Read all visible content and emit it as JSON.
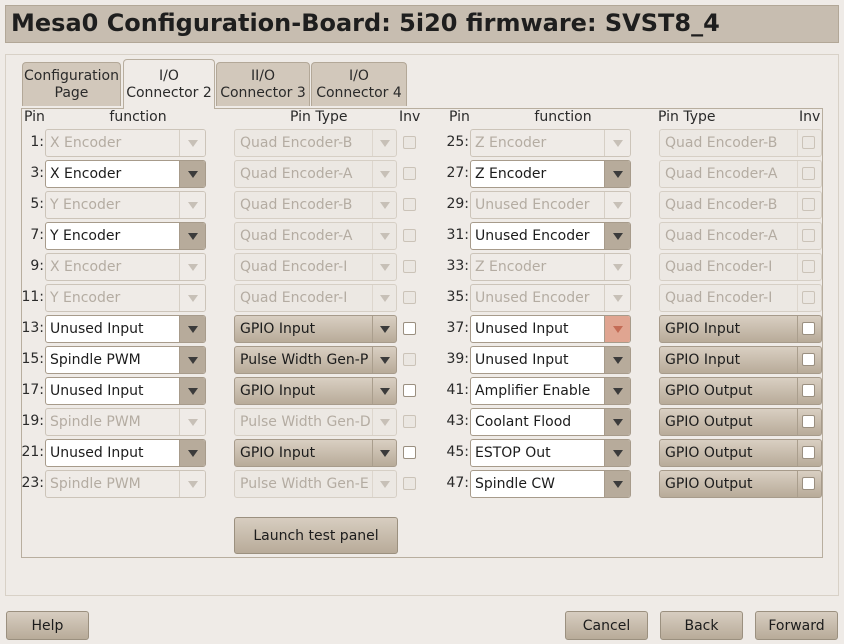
{
  "window": {
    "title": "Mesa0 Configuration-Board: 5i20 firmware: SVST8_4"
  },
  "tabs": [
    {
      "label": "Configuration\nPage",
      "active": false
    },
    {
      "label": "I/O\nConnector 2",
      "active": true
    },
    {
      "label": "II/O\nConnector 3",
      "active": false
    },
    {
      "label": "I/O\nConnector 4",
      "active": false
    }
  ],
  "columns": {
    "pin": "Pin",
    "function": "function",
    "pin_type": "Pin Type",
    "inv": "Inv"
  },
  "left_rows": [
    {
      "pin": "1:",
      "function": "X Encoder",
      "pin_type": "Quad Encoder-B",
      "enabled": false,
      "inv_enabled": false
    },
    {
      "pin": "3:",
      "function": "X Encoder",
      "pin_type": "Quad Encoder-A",
      "enabled": true,
      "type_enabled": false,
      "inv_enabled": false
    },
    {
      "pin": "5:",
      "function": "Y Encoder",
      "pin_type": "Quad Encoder-B",
      "enabled": false,
      "inv_enabled": false
    },
    {
      "pin": "7:",
      "function": "Y Encoder",
      "pin_type": "Quad Encoder-A",
      "enabled": true,
      "type_enabled": false,
      "inv_enabled": false
    },
    {
      "pin": "9:",
      "function": "X Encoder",
      "pin_type": "Quad Encoder-I",
      "enabled": false,
      "inv_enabled": false
    },
    {
      "pin": "11:",
      "function": "Y Encoder",
      "pin_type": "Quad Encoder-I",
      "enabled": false,
      "inv_enabled": false
    },
    {
      "pin": "13:",
      "function": "Unused Input",
      "pin_type": "GPIO Input",
      "enabled": true,
      "type_enabled": true,
      "inv_enabled": true
    },
    {
      "pin": "15:",
      "function": "Spindle PWM",
      "pin_type": "Pulse Width Gen-P",
      "enabled": true,
      "type_enabled": true,
      "inv_enabled": false
    },
    {
      "pin": "17:",
      "function": "Unused Input",
      "pin_type": "GPIO Input",
      "enabled": true,
      "type_enabled": true,
      "inv_enabled": true
    },
    {
      "pin": "19:",
      "function": "Spindle PWM",
      "pin_type": "Pulse Width Gen-D",
      "enabled": false,
      "inv_enabled": false
    },
    {
      "pin": "21:",
      "function": "Unused Input",
      "pin_type": "GPIO Input",
      "enabled": true,
      "type_enabled": true,
      "inv_enabled": true
    },
    {
      "pin": "23:",
      "function": "Spindle PWM",
      "pin_type": "Pulse Width Gen-E",
      "enabled": false,
      "inv_enabled": false
    }
  ],
  "right_rows": [
    {
      "pin": "25:",
      "function": "Z Encoder",
      "pin_type": "Quad Encoder-B",
      "enabled": false,
      "inv_enabled": false
    },
    {
      "pin": "27:",
      "function": "Z Encoder",
      "pin_type": "Quad Encoder-A",
      "enabled": true,
      "type_enabled": false,
      "inv_enabled": false
    },
    {
      "pin": "29:",
      "function": "Unused Encoder",
      "pin_type": "Quad Encoder-B",
      "enabled": false,
      "inv_enabled": false
    },
    {
      "pin": "31:",
      "function": "Unused Encoder",
      "pin_type": "Quad Encoder-A",
      "enabled": true,
      "type_enabled": false,
      "inv_enabled": false
    },
    {
      "pin": "33:",
      "function": "Z Encoder",
      "pin_type": "Quad Encoder-I",
      "enabled": false,
      "inv_enabled": false
    },
    {
      "pin": "35:",
      "function": "Unused Encoder",
      "pin_type": "Quad Encoder-I",
      "enabled": false,
      "inv_enabled": false
    },
    {
      "pin": "37:",
      "function": "Unused Input",
      "pin_type": "GPIO Input",
      "enabled": true,
      "type_enabled": true,
      "inv_enabled": true,
      "highlight": true
    },
    {
      "pin": "39:",
      "function": "Unused Input",
      "pin_type": "GPIO Input",
      "enabled": true,
      "type_enabled": true,
      "inv_enabled": true
    },
    {
      "pin": "41:",
      "function": "Amplifier Enable",
      "pin_type": "GPIO Output",
      "enabled": true,
      "type_enabled": true,
      "inv_enabled": true
    },
    {
      "pin": "43:",
      "function": "Coolant Flood",
      "pin_type": "GPIO Output",
      "enabled": true,
      "type_enabled": true,
      "inv_enabled": true
    },
    {
      "pin": "45:",
      "function": "ESTOP Out",
      "pin_type": "GPIO Output",
      "enabled": true,
      "type_enabled": true,
      "inv_enabled": true
    },
    {
      "pin": "47:",
      "function": "Spindle CW",
      "pin_type": "GPIO Output",
      "enabled": true,
      "type_enabled": true,
      "inv_enabled": true
    }
  ],
  "launch_button": "Launch test panel",
  "footer": {
    "help": "Help",
    "cancel": "Cancel",
    "back": "Back",
    "forward": "Forward"
  }
}
